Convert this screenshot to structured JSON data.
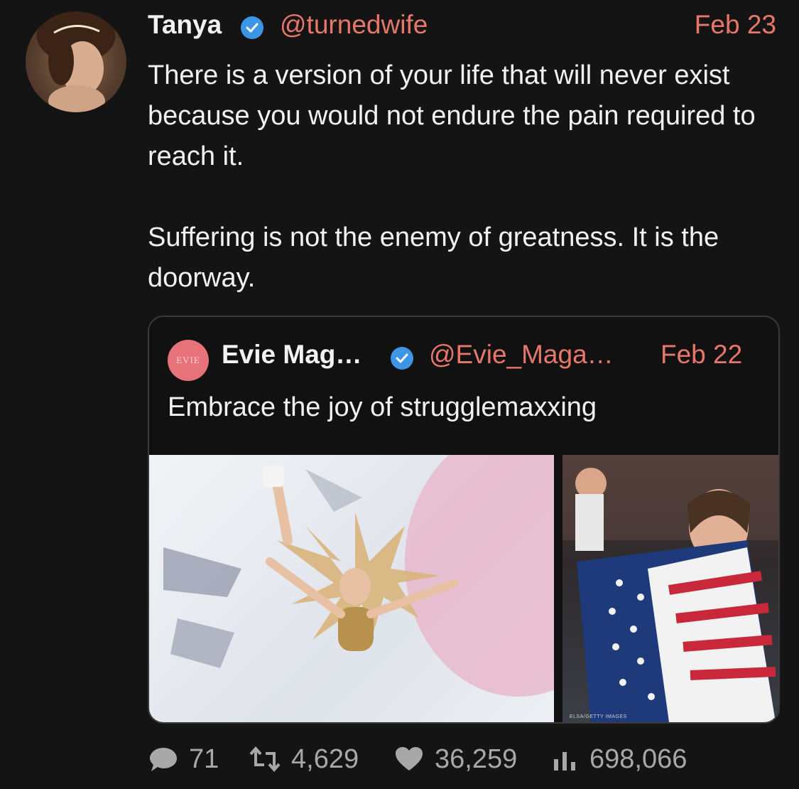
{
  "tweet": {
    "author_name": "Tanya",
    "handle": "@turnedwife",
    "date": "Feb 23",
    "paragraphs": [
      "There is a version of your life that will never exist because you would not endure the pain required to reach it.",
      "Suffering is not the enemy of greatness. It is the doorway."
    ]
  },
  "quote": {
    "avatar_text": "EVIE",
    "author_name": "Evie Mag…",
    "handle": "@Evie_Maga…",
    "date": "Feb 22",
    "text": "Embrace the joy of strugglemaxxing",
    "photo_credit": "ELSA/GETTY IMAGES"
  },
  "stats": {
    "replies": "71",
    "retweets": "4,629",
    "likes": "36,259",
    "views": "698,066"
  },
  "icons": {
    "verified": "verified-badge-icon",
    "reply": "comment-bubble-icon",
    "retweet": "retweet-icon",
    "like": "heart-icon",
    "views": "bar-chart-icon"
  },
  "colors": {
    "background": "#141414",
    "accent_link": "#e8776a",
    "verified_blue": "#3d95e6",
    "muted": "#a8a8a8"
  }
}
